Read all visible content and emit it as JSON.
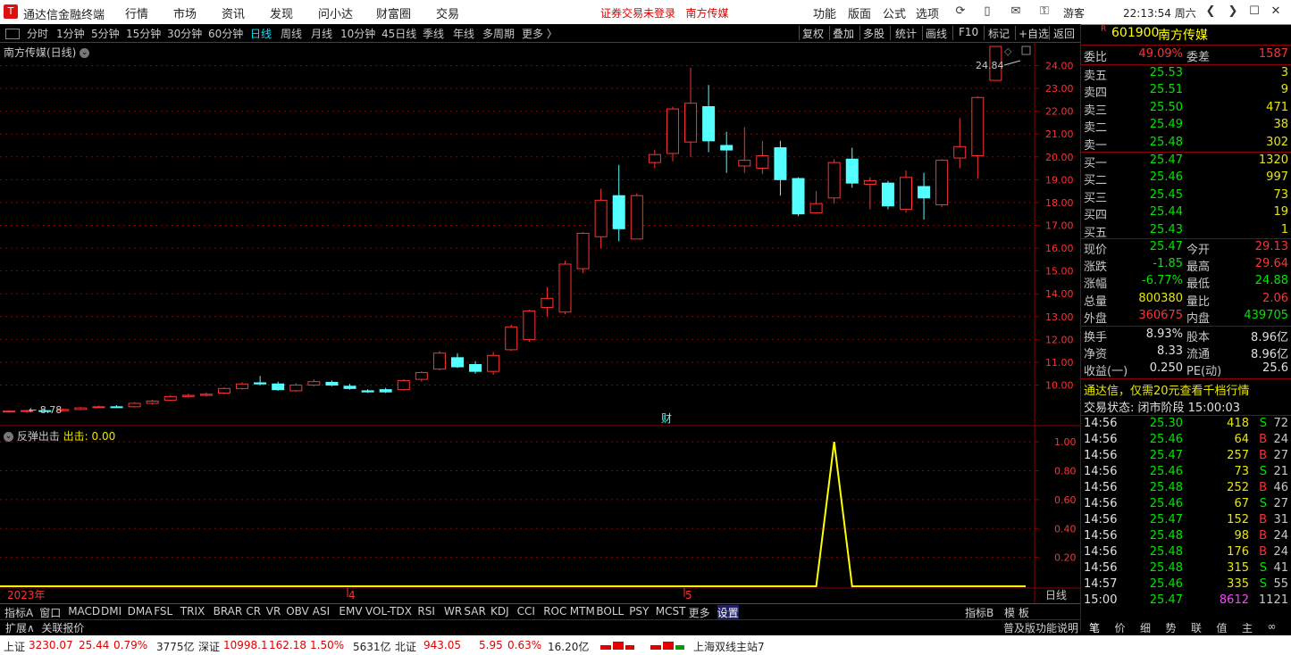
{
  "app": {
    "title": "通达信金融终端",
    "logo": "T"
  },
  "top_menu": [
    "行情",
    "市场",
    "资讯",
    "发现",
    "问小达",
    "财富圈",
    "交易"
  ],
  "notice": "证券交易未登录   南方传媒",
  "right_menu": [
    "功能",
    "版面",
    "公式",
    "选项"
  ],
  "user": "游客",
  "clock": "22:13:54 周六",
  "periods": [
    "分时",
    "1分钟",
    "5分钟",
    "15分钟",
    "30分钟",
    "60分钟",
    "日线",
    "周线",
    "月线",
    "10分钟",
    "45日线",
    "季线",
    "年线",
    "多周期",
    "更多 〉"
  ],
  "active_period": "日线",
  "chart_tools": [
    "复权",
    "叠加",
    "多股",
    "统计",
    "画线",
    "F10",
    "标记",
    "+自选",
    "返回"
  ],
  "chart_title": "南方传媒(日线)",
  "indicator_title": "反弹出击",
  "indicator_value_label": "出击: 0.00",
  "price_high_label": "24.84",
  "price_low_label": "8.78",
  "fin_marker": "财",
  "x_labels": [
    "2023年",
    "4",
    "5"
  ],
  "x_unit": "日线",
  "chart_data": {
    "type": "candlestick",
    "ylim": [
      8.3,
      24.8
    ],
    "y_ticks": [
      "24.00",
      "23.00",
      "22.00",
      "21.00",
      "20.00",
      "19.00",
      "18.00",
      "17.00",
      "16.00",
      "15.00",
      "14.00",
      "13.00",
      "12.00",
      "11.00",
      "10.00"
    ],
    "candles": [
      [
        8.86,
        8.86,
        8.9,
        8.8
      ],
      [
        8.85,
        8.88,
        8.92,
        8.78
      ],
      [
        8.88,
        8.86,
        8.95,
        8.82
      ],
      [
        8.88,
        8.93,
        8.98,
        8.84
      ],
      [
        8.93,
        9.0,
        9.04,
        8.9
      ],
      [
        9.02,
        9.05,
        9.1,
        8.98
      ],
      [
        9.05,
        9.02,
        9.12,
        8.99
      ],
      [
        9.05,
        9.2,
        9.26,
        9.02
      ],
      [
        9.2,
        9.3,
        9.36,
        9.15
      ],
      [
        9.34,
        9.5,
        9.56,
        9.3
      ],
      [
        9.5,
        9.55,
        9.62,
        9.45
      ],
      [
        9.55,
        9.6,
        9.68,
        9.5
      ],
      [
        9.65,
        9.85,
        9.9,
        9.6
      ],
      [
        9.85,
        10.05,
        10.12,
        9.8
      ],
      [
        10.1,
        10.05,
        10.4,
        9.98
      ],
      [
        10.05,
        9.8,
        10.15,
        9.75
      ],
      [
        9.75,
        10.0,
        10.08,
        9.7
      ],
      [
        10.0,
        10.15,
        10.25,
        9.95
      ],
      [
        10.12,
        10.0,
        10.2,
        9.95
      ],
      [
        9.95,
        9.85,
        10.05,
        9.8
      ],
      [
        9.75,
        9.7,
        9.82,
        9.65
      ],
      [
        9.8,
        9.7,
        9.88,
        9.65
      ],
      [
        9.8,
        10.2,
        10.25,
        9.75
      ],
      [
        10.25,
        10.55,
        10.6,
        10.15
      ],
      [
        10.7,
        11.4,
        11.5,
        10.65
      ],
      [
        11.2,
        10.8,
        11.4,
        10.75
      ],
      [
        10.9,
        10.6,
        11.05,
        10.5
      ],
      [
        10.6,
        11.3,
        11.45,
        10.45
      ],
      [
        11.55,
        12.55,
        12.65,
        11.5
      ],
      [
        12.0,
        13.25,
        13.3,
        11.9
      ],
      [
        13.4,
        13.8,
        14.3,
        13.0
      ],
      [
        13.2,
        15.3,
        15.45,
        13.1
      ],
      [
        15.1,
        16.65,
        16.7,
        14.9
      ],
      [
        16.5,
        18.1,
        18.6,
        16.0
      ],
      [
        18.3,
        16.85,
        19.65,
        16.3
      ],
      [
        16.4,
        18.3,
        18.4,
        16.4
      ],
      [
        19.75,
        20.1,
        20.3,
        19.5
      ],
      [
        20.15,
        22.1,
        22.2,
        19.8
      ],
      [
        20.65,
        22.35,
        23.9,
        20.0
      ],
      [
        22.2,
        20.7,
        23.15,
        20.2
      ],
      [
        20.5,
        20.3,
        21.1,
        19.3
      ],
      [
        19.6,
        19.85,
        21.3,
        19.3
      ],
      [
        19.5,
        20.05,
        20.7,
        19.25
      ],
      [
        20.4,
        19.0,
        20.7,
        18.3
      ],
      [
        19.05,
        17.5,
        19.1,
        17.4
      ],
      [
        17.55,
        17.95,
        18.5,
        17.55
      ],
      [
        18.2,
        19.75,
        19.9,
        17.95
      ],
      [
        19.9,
        18.85,
        20.4,
        18.65
      ],
      [
        18.8,
        18.95,
        19.1,
        17.7
      ],
      [
        18.85,
        17.85,
        18.95,
        17.7
      ],
      [
        17.7,
        19.1,
        19.4,
        17.55
      ],
      [
        18.7,
        18.2,
        19.3,
        17.25
      ],
      [
        17.9,
        19.85,
        19.9,
        17.8
      ],
      [
        19.95,
        20.45,
        21.7,
        19.5
      ],
      [
        20.05,
        22.6,
        22.65,
        19.05
      ],
      [
        23.35,
        24.84,
        24.84,
        23.35
      ]
    ],
    "indicator": {
      "name": "出击",
      "ylim": [
        0,
        1.1
      ],
      "y_ticks": [
        "1.00",
        "0.80",
        "0.60",
        "0.40",
        "0.20"
      ],
      "spike_index": 46,
      "value": 0.0
    }
  },
  "quote": {
    "code": "601900",
    "name": "南方传媒",
    "flag": "R",
    "wei_bi_label": "委比",
    "wei_bi": "49.09%",
    "wei_cha_label": "委差",
    "wei_cha": "1587",
    "asks": [
      {
        "label": "卖五",
        "price": "25.53",
        "vol": "3"
      },
      {
        "label": "卖四",
        "price": "25.51",
        "vol": "9"
      },
      {
        "label": "卖三",
        "price": "25.50",
        "vol": "471"
      },
      {
        "label": "卖二",
        "price": "25.49",
        "vol": "38"
      },
      {
        "label": "卖一",
        "price": "25.48",
        "vol": "302"
      }
    ],
    "bids": [
      {
        "label": "买一",
        "price": "25.47",
        "vol": "1320"
      },
      {
        "label": "买二",
        "price": "25.46",
        "vol": "997"
      },
      {
        "label": "买三",
        "price": "25.45",
        "vol": "73"
      },
      {
        "label": "买四",
        "price": "25.44",
        "vol": "19"
      },
      {
        "label": "买五",
        "price": "25.43",
        "vol": "1"
      }
    ],
    "stats": [
      {
        "l1": "现价",
        "v1": "25.47",
        "c1": "grn",
        "l2": "今开",
        "v2": "29.13",
        "c2": "red"
      },
      {
        "l1": "涨跌",
        "v1": "-1.85",
        "c1": "grn",
        "l2": "最高",
        "v2": "29.64",
        "c2": "red"
      },
      {
        "l1": "涨幅",
        "v1": "-6.77%",
        "c1": "grn",
        "l2": "最低",
        "v2": "24.88",
        "c2": "grn"
      },
      {
        "l1": "总量",
        "v1": "800380",
        "c1": "yel",
        "l2": "量比",
        "v2": "2.06",
        "c2": "red"
      },
      {
        "l1": "外盘",
        "v1": "360675",
        "c1": "red",
        "l2": "内盘",
        "v2": "439705",
        "c2": "grn"
      }
    ],
    "fund": [
      {
        "l1": "换手",
        "v1": "8.93%",
        "l2": "股本",
        "v2": "8.96亿"
      },
      {
        "l1": "净资",
        "v1": "8.33",
        "l2": "流通",
        "v2": "8.96亿"
      },
      {
        "l1": "收益(一)",
        "v1": "0.250",
        "l2": "PE(动)",
        "v2": "25.6"
      }
    ],
    "promo": "通达信，仅需20元查看千档行情",
    "trade_status": "交易状态: 闭市阶段 15:00:03",
    "ticks": [
      {
        "t": "14:56",
        "p": "25.30",
        "v": "418",
        "d": "S",
        "n": "72"
      },
      {
        "t": "14:56",
        "p": "25.46",
        "v": "64",
        "d": "B",
        "n": "24"
      },
      {
        "t": "14:56",
        "p": "25.47",
        "v": "257",
        "d": "B",
        "n": "27"
      },
      {
        "t": "14:56",
        "p": "25.46",
        "v": "73",
        "d": "S",
        "n": "21"
      },
      {
        "t": "14:56",
        "p": "25.48",
        "v": "252",
        "d": "B",
        "n": "46"
      },
      {
        "t": "14:56",
        "p": "25.46",
        "v": "67",
        "d": "S",
        "n": "27"
      },
      {
        "t": "14:56",
        "p": "25.47",
        "v": "152",
        "d": "B",
        "n": "31"
      },
      {
        "t": "14:56",
        "p": "25.48",
        "v": "98",
        "d": "B",
        "n": "24"
      },
      {
        "t": "14:56",
        "p": "25.48",
        "v": "176",
        "d": "B",
        "n": "24"
      },
      {
        "t": "14:56",
        "p": "25.48",
        "v": "315",
        "d": "S",
        "n": "41"
      },
      {
        "t": "14:57",
        "p": "25.46",
        "v": "335",
        "d": "S",
        "n": "55"
      },
      {
        "t": "15:00",
        "p": "25.47",
        "v": "8612",
        "d": "",
        "n": "1121"
      }
    ],
    "bottom_tabs": [
      "笔",
      "价",
      "细",
      "势",
      "联",
      "值",
      "主",
      "∞"
    ]
  },
  "indicator_tabs": [
    "指标A",
    "窗口",
    "MACD",
    "DMI",
    "DMA",
    "FSL",
    "TRIX",
    "BRAR",
    "CR",
    "VR",
    "OBV",
    "ASI",
    "EMV",
    "VOL-TDX",
    "RSI",
    "WR",
    "SAR",
    "KDJ",
    "CCI",
    "ROC",
    "MTM",
    "BOLL",
    "PSY",
    "MCST",
    "更多",
    "设置"
  ],
  "indicator_right": [
    "指标B",
    "模 板"
  ],
  "ext_left": "扩展∧  关联报价",
  "ext_right": "普及版功能说明",
  "status": {
    "sh": "上证",
    "sh_val": "3230.07",
    "sh_chg": "25.44",
    "sh_pct": "0.79%",
    "sh_amt": "3775亿",
    "sz": "深证",
    "sz_val": "10998.1",
    "sz_chg": "162.18",
    "sz_pct": "1.50%",
    "sz_amt": "5631亿",
    "bz": "北证",
    "bz_val": "943.05",
    "bz_chg": "5.95",
    "bz_pct": "0.63%",
    "bz_amt": "16.20亿",
    "server": "上海双线主站7"
  },
  "colors": {
    "up": "#ff3232",
    "down": "#54ffff",
    "axis": "#8b0000",
    "indicator": "#ffff00"
  }
}
